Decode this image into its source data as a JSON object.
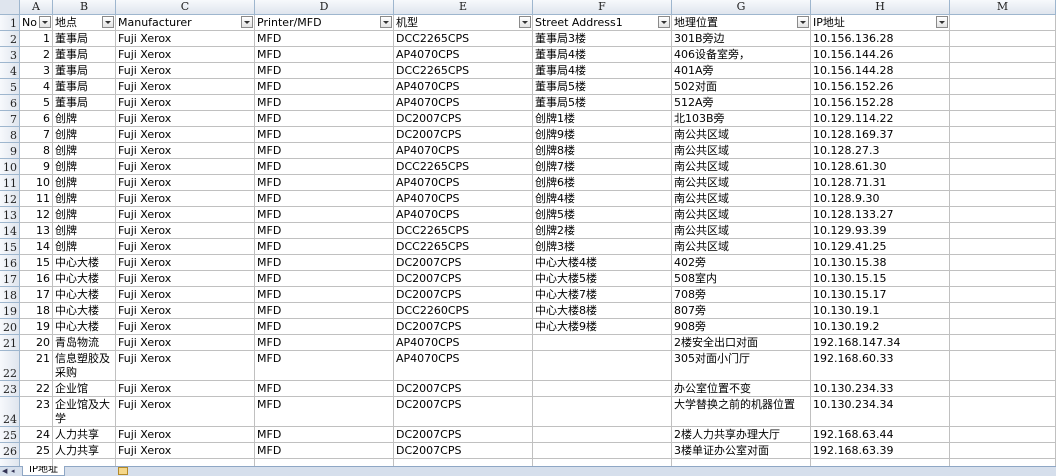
{
  "columns": [
    {
      "letter": "A"
    },
    {
      "letter": "B"
    },
    {
      "letter": "C"
    },
    {
      "letter": "D"
    },
    {
      "letter": "E"
    },
    {
      "letter": "F"
    },
    {
      "letter": "G"
    },
    {
      "letter": "H"
    },
    {
      "letter": "M"
    }
  ],
  "headers": [
    "No",
    "地点",
    "Manufacturer",
    "Printer/MFD",
    "机型",
    "Street Address1",
    "地理位置",
    "IP地址"
  ],
  "rows": [
    {
      "r": "2",
      "no": "1",
      "loc": "董事局",
      "mfr": "Fuji Xerox",
      "type": "MFD",
      "model": "DCC2265CPS",
      "addr": "董事局3楼",
      "geo": "301B旁边",
      "ip": "10.156.136.28"
    },
    {
      "r": "3",
      "no": "2",
      "loc": "董事局",
      "mfr": "Fuji Xerox",
      "type": "MFD",
      "model": "AP4070CPS",
      "addr": "董事局4楼",
      "geo": "406设备室旁，",
      "ip": "10.156.144.26"
    },
    {
      "r": "4",
      "no": "3",
      "loc": "董事局",
      "mfr": "Fuji Xerox",
      "type": "MFD",
      "model": "DCC2265CPS",
      "addr": "董事局4楼",
      "geo": "401A旁",
      "ip": "10.156.144.28"
    },
    {
      "r": "5",
      "no": "4",
      "loc": "董事局",
      "mfr": "Fuji Xerox",
      "type": "MFD",
      "model": "AP4070CPS",
      "addr": "董事局5楼",
      "geo": "502对面",
      "ip": "10.156.152.26"
    },
    {
      "r": "6",
      "no": "5",
      "loc": "董事局",
      "mfr": "Fuji Xerox",
      "type": "MFD",
      "model": "AP4070CPS",
      "addr": "董事局5楼",
      "geo": "512A旁",
      "ip": "10.156.152.28"
    },
    {
      "r": "7",
      "no": "6",
      "loc": "创牌",
      "mfr": "Fuji Xerox",
      "type": "MFD",
      "model": "DC2007CPS",
      "addr": "创牌1楼",
      "geo": "北103B旁",
      "ip": "10.129.114.22"
    },
    {
      "r": "8",
      "no": "7",
      "loc": "创牌",
      "mfr": "Fuji Xerox",
      "type": "MFD",
      "model": "DC2007CPS",
      "addr": "创牌9楼",
      "geo": "南公共区域",
      "ip": "10.128.169.37"
    },
    {
      "r": "9",
      "no": "8",
      "loc": "创牌",
      "mfr": "Fuji Xerox",
      "type": "MFD",
      "model": "AP4070CPS",
      "addr": "创牌8楼",
      "geo": "南公共区域",
      "ip": "10.128.27.3"
    },
    {
      "r": "10",
      "no": "9",
      "loc": "创牌",
      "mfr": "Fuji Xerox",
      "type": "MFD",
      "model": "DCC2265CPS",
      "addr": "创牌7楼",
      "geo": "南公共区域",
      "ip": "10.128.61.30"
    },
    {
      "r": "11",
      "no": "10",
      "loc": "创牌",
      "mfr": "Fuji Xerox",
      "type": "MFD",
      "model": "AP4070CPS",
      "addr": "创牌6楼",
      "geo": "南公共区域",
      "ip": "10.128.71.31"
    },
    {
      "r": "12",
      "no": "11",
      "loc": "创牌",
      "mfr": "Fuji Xerox",
      "type": "MFD",
      "model": "AP4070CPS",
      "addr": "创牌4楼",
      "geo": "南公共区域",
      "ip": "10.128.9.30"
    },
    {
      "r": "13",
      "no": "12",
      "loc": "创牌",
      "mfr": "Fuji Xerox",
      "type": "MFD",
      "model": "AP4070CPS",
      "addr": "创牌5楼",
      "geo": "南公共区域",
      "ip": "10.128.133.27"
    },
    {
      "r": "14",
      "no": "13",
      "loc": "创牌",
      "mfr": "Fuji Xerox",
      "type": "MFD",
      "model": "DCC2265CPS",
      "addr": "创牌2楼",
      "geo": "南公共区域",
      "ip": "10.129.93.39"
    },
    {
      "r": "15",
      "no": "14",
      "loc": "创牌",
      "mfr": "Fuji Xerox",
      "type": "MFD",
      "model": "DCC2265CPS",
      "addr": "创牌3楼",
      "geo": "南公共区域",
      "ip": "10.129.41.25"
    },
    {
      "r": "16",
      "no": "15",
      "loc": "中心大楼",
      "mfr": "Fuji Xerox",
      "type": "MFD",
      "model": "DC2007CPS",
      "addr": "中心大楼4楼",
      "geo": "402旁",
      "ip": "10.130.15.38"
    },
    {
      "r": "17",
      "no": "16",
      "loc": "中心大楼",
      "mfr": "Fuji Xerox",
      "type": "MFD",
      "model": "DC2007CPS",
      "addr": "中心大楼5楼",
      "geo": "508室内",
      "ip": "10.130.15.15"
    },
    {
      "r": "18",
      "no": "17",
      "loc": "中心大楼",
      "mfr": "Fuji Xerox",
      "type": "MFD",
      "model": "DC2007CPS",
      "addr": "中心大楼7楼",
      "geo": "708旁",
      "ip": "10.130.15.17"
    },
    {
      "r": "19",
      "no": "18",
      "loc": "中心大楼",
      "mfr": "Fuji Xerox",
      "type": "MFD",
      "model": "DCC2260CPS",
      "addr": "中心大楼8楼",
      "geo": "807旁",
      "ip": "10.130.19.1"
    },
    {
      "r": "20",
      "no": "19",
      "loc": "中心大楼",
      "mfr": "Fuji Xerox",
      "type": "MFD",
      "model": "DC2007CPS",
      "addr": "中心大楼9楼",
      "geo": "908旁",
      "ip": "10.130.19.2"
    },
    {
      "r": "21",
      "no": "20",
      "loc": "青岛物流",
      "mfr": "Fuji Xerox",
      "type": "MFD",
      "model": "AP4070CPS",
      "addr": "",
      "geo": "2楼安全出口对面",
      "ip": "192.168.147.34"
    },
    {
      "r": "22",
      "no": "21",
      "loc": "信息塑胶及采购",
      "mfr": "Fuji Xerox",
      "type": "MFD",
      "model": "AP4070CPS",
      "addr": "",
      "geo": "305对面小门厅",
      "ip": "192.168.60.33"
    },
    {
      "r": "23",
      "no": "22",
      "loc": "企业馆",
      "mfr": "Fuji Xerox",
      "type": "MFD",
      "model": "DC2007CPS",
      "addr": "",
      "geo": "办公室位置不变",
      "ip": "10.130.234.33"
    },
    {
      "r": "24",
      "no": "23",
      "loc": "企业馆及大学",
      "mfr": "Fuji Xerox",
      "type": "MFD",
      "model": "DC2007CPS",
      "addr": "",
      "geo": "大学替换之前的机器位置",
      "ip": "10.130.234.34"
    },
    {
      "r": "25",
      "no": "24",
      "loc": "人力共享",
      "mfr": "Fuji Xerox",
      "type": "MFD",
      "model": "DC2007CPS",
      "addr": "",
      "geo": "2楼人力共享办理大厅",
      "ip": "192.168.63.44"
    },
    {
      "r": "26",
      "no": "25",
      "loc": "人力共享",
      "mfr": "Fuji Xerox",
      "type": "MFD",
      "model": "DC2007CPS",
      "addr": "",
      "geo": "3楼单证办公室对面",
      "ip": "192.168.63.39"
    }
  ],
  "sheet_tab": "IP地址"
}
